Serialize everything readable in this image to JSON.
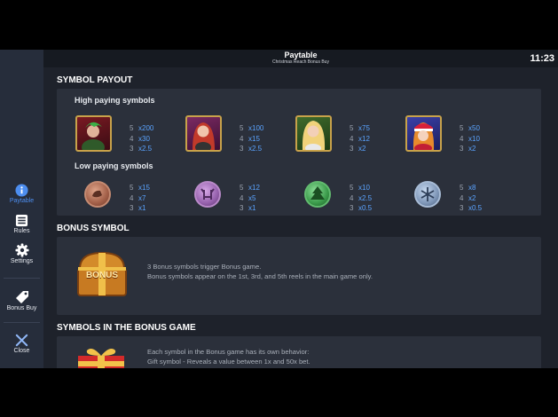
{
  "header": {
    "title": "Paytable",
    "subtitle": "Christmas Reach Bonus Buy",
    "clock": "11:23"
  },
  "sidebar": {
    "items": [
      {
        "label": "Paytable",
        "icon": "info-icon",
        "active": true
      },
      {
        "label": "Rules",
        "icon": "rules-icon"
      },
      {
        "label": "Settings",
        "icon": "gear-icon"
      },
      {
        "label": "Bonus Buy",
        "icon": "tag-icon"
      },
      {
        "label": "Close",
        "icon": "close-icon"
      }
    ]
  },
  "symbol_payout": {
    "title": "SYMBOL PAYOUT",
    "high_title": "High paying symbols",
    "low_title": "Low paying symbols",
    "high": [
      {
        "name": "green-haired-elf",
        "pays": [
          [
            "5",
            "x200"
          ],
          [
            "4",
            "x30"
          ],
          [
            "3",
            "x2.5"
          ]
        ]
      },
      {
        "name": "red-haired-lady",
        "pays": [
          [
            "5",
            "x100"
          ],
          [
            "4",
            "x15"
          ],
          [
            "3",
            "x2.5"
          ]
        ]
      },
      {
        "name": "blonde-lady",
        "pays": [
          [
            "5",
            "x75"
          ],
          [
            "4",
            "x12"
          ],
          [
            "3",
            "x2"
          ]
        ]
      },
      {
        "name": "snow-maiden",
        "pays": [
          [
            "5",
            "x50"
          ],
          [
            "4",
            "x10"
          ],
          [
            "3",
            "x2"
          ]
        ]
      }
    ],
    "low": [
      {
        "name": "bronze-sleigh-coin",
        "pays": [
          [
            "5",
            "x15"
          ],
          [
            "4",
            "x7"
          ],
          [
            "3",
            "x1"
          ]
        ]
      },
      {
        "name": "purple-antler-coin",
        "pays": [
          [
            "5",
            "x12"
          ],
          [
            "4",
            "x5"
          ],
          [
            "3",
            "x1"
          ]
        ]
      },
      {
        "name": "green-tree-coin",
        "pays": [
          [
            "5",
            "x10"
          ],
          [
            "4",
            "x2.5"
          ],
          [
            "3",
            "x0.5"
          ]
        ]
      },
      {
        "name": "blue-snowflake-coin",
        "pays": [
          [
            "5",
            "x8"
          ],
          [
            "4",
            "x2"
          ],
          [
            "3",
            "x0.5"
          ]
        ]
      }
    ]
  },
  "bonus_symbol": {
    "title": "BONUS SYMBOL",
    "chest_label": "BONUS",
    "line1": "3 Bonus symbols trigger Bonus game.",
    "line2": "Bonus symbols appear on the 1st, 3rd, and 5th reels in the main game only."
  },
  "bonus_game": {
    "title": "SYMBOLS IN THE BONUS GAME",
    "line1": "Each symbol in the Bonus game has its own behavior:",
    "line2": "Gift symbol - Reveals a value between 1x and 50x bet."
  },
  "colors": {
    "accent": "#4d8ef0",
    "multiplier": "#5aa3ff",
    "gold_frame": "#c8a24a"
  }
}
